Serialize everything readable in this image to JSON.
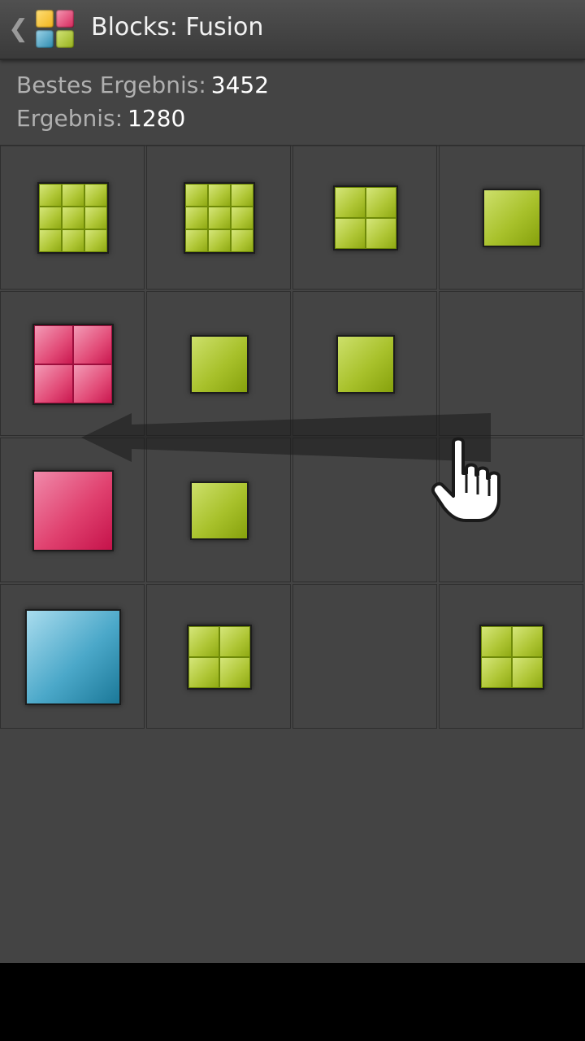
{
  "app": {
    "title": "Blocks: Fusion",
    "back_glyph": "❮",
    "logo_icon": "blocks-logo-icon"
  },
  "scores": {
    "best_label": "Bestes Ergebnis:",
    "best_value": "3452",
    "current_label": "Ergebnis:",
    "current_value": "1280"
  },
  "board": {
    "size": 4,
    "tiles": [
      {
        "row": 0,
        "col": 0,
        "color": "green",
        "subdiv": 3
      },
      {
        "row": 0,
        "col": 1,
        "color": "green",
        "subdiv": 3
      },
      {
        "row": 0,
        "col": 2,
        "color": "green",
        "subdiv": 2
      },
      {
        "row": 0,
        "col": 3,
        "color": "green",
        "subdiv": 1
      },
      {
        "row": 1,
        "col": 0,
        "color": "pink",
        "subdiv": 2
      },
      {
        "row": 1,
        "col": 1,
        "color": "green",
        "subdiv": 1
      },
      {
        "row": 1,
        "col": 2,
        "color": "green",
        "subdiv": 1
      },
      {
        "row": 2,
        "col": 0,
        "color": "pink",
        "subdiv": 1
      },
      {
        "row": 2,
        "col": 1,
        "color": "green",
        "subdiv": 1
      },
      {
        "row": 3,
        "col": 0,
        "color": "blue",
        "subdiv": 1
      },
      {
        "row": 3,
        "col": 1,
        "color": "green",
        "subdiv": 2
      },
      {
        "row": 3,
        "col": 3,
        "color": "green",
        "subdiv": 2
      }
    ]
  },
  "hint": {
    "gesture": "swipe-left",
    "icons": [
      "swipe-arrow-icon",
      "pointing-hand-icon"
    ]
  },
  "colors": {
    "green": "#a8c12b",
    "pink": "#e0416f",
    "blue": "#4ba8c9",
    "background": "#444444"
  }
}
